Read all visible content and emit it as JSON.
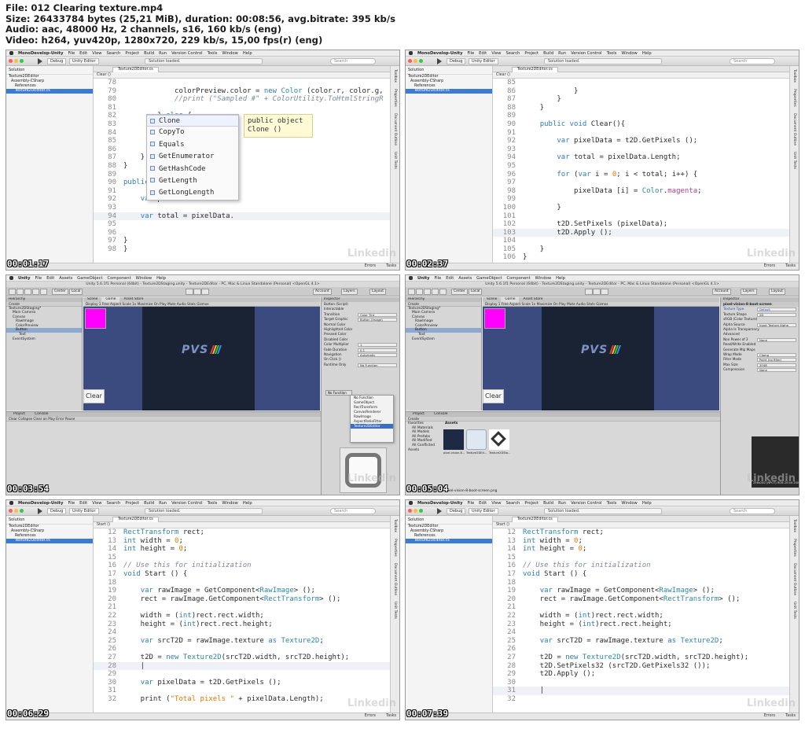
{
  "header": {
    "line1": "File: 012 Clearing texture.mp4",
    "line2": "Size: 26433784 bytes (25,21 MiB), duration: 00:08:56, avg.bitrate: 395 kb/s",
    "line3": "Audio: aac, 48000 Hz, 2 channels, s16, 160 kb/s (eng)",
    "line4": "Video: h264, yuv420p, 1280x720, 229 kb/s, 15,00 fps(r) (eng)"
  },
  "watermark": "Linkedin",
  "colors": {
    "accent_blue": "#3b7bd6",
    "keyword": "#2f7bbf",
    "number": "#e07800",
    "magenta": "#ff00ff",
    "game_bg": "#3b4b80"
  },
  "monodevelop": {
    "menu": [
      "MonoDevelop-Unity",
      "File",
      "Edit",
      "View",
      "Search",
      "Project",
      "Build",
      "Run",
      "Version Control",
      "Tools",
      "Window",
      "Help"
    ],
    "config": "Debug",
    "target": "Unity Editor",
    "status": "Solution loaded.",
    "search_placeholder": "Search",
    "sidebar_title": "Solution",
    "tree": [
      "Texture2DEditor",
      "Assembly-CSharp",
      "References",
      "Texture2DEditor.cs"
    ],
    "tab": "Texture2DEditor.cs",
    "right_pads": [
      "Toolbox",
      "Properties",
      "Document Outline",
      "Unit Tests"
    ],
    "status_right": [
      "Errors",
      "Tasks"
    ]
  },
  "unity": {
    "menu": [
      "Unity",
      "File",
      "Edit",
      "Assets",
      "GameObject",
      "Component",
      "Window",
      "Help"
    ],
    "title": "Unity 5.6.1f1 Personal (64bit) - Texture2DStaging.unity - Texture2DEditor - PC, Mac & Linux Standalone (Personal) <OpenGL 4.1>",
    "pivot": "Center",
    "space": "Local",
    "account": "Account",
    "layers": "Layers",
    "layout": "Layout",
    "hierarchy_tab": "Hierarchy",
    "hierarchy_create": "Create",
    "hierarchy_items": [
      "Texture2DStaging*",
      "Main Camera",
      "Canvas",
      "RawImage",
      "ColorPreview",
      "Button",
      "Text",
      "EventSystem"
    ],
    "scene_tabs": [
      "Scene",
      "Game",
      "Asset Store"
    ],
    "game_bar": "Display 1   Free Aspect   Scale   1x   Maximize On Play   Mute Audio   Stats   Gizmos",
    "clear_button": "Clear",
    "logo_text": "PVS",
    "project_tabs": [
      "Project",
      "Console"
    ],
    "console_bar": "Clear   Collapse   Clear on Play   Error Pause",
    "inspector_tab": "Inspector",
    "button_inspector": [
      {
        "label": "Button (Script)",
        "value": ""
      },
      {
        "label": "Interactable",
        "value": ""
      },
      {
        "label": "Transition",
        "value": "Color Tint"
      },
      {
        "label": "Target Graphic",
        "value": "Button (Image)"
      },
      {
        "label": "Normal Color",
        "value": ""
      },
      {
        "label": "Highlighted Color",
        "value": ""
      },
      {
        "label": "Pressed Color",
        "value": ""
      },
      {
        "label": "Disabled Color",
        "value": ""
      },
      {
        "label": "Color Multiplier",
        "value": "1"
      },
      {
        "label": "Fade Duration",
        "value": "0.1"
      },
      {
        "label": "Navigation",
        "value": "Automatic"
      },
      {
        "label": "On Click ()",
        "value": ""
      },
      {
        "label": "Runtime Only",
        "value": "No Function"
      }
    ],
    "context_menu_top": "No Function",
    "context_menu": [
      "No Function",
      "GameObject",
      "RectTransform",
      "CanvasRenderer",
      "RawImage",
      "AspectRatioFitter",
      "Texture2DEditor"
    ],
    "preview_label": "Button",
    "texture_inspector_name": "pixel-vision-8-boot-screen",
    "texture_inspector": [
      {
        "label": "Texture Type",
        "value": "Default"
      },
      {
        "label": "Texture Shape",
        "value": "2D"
      },
      {
        "label": "sRGB (Color Texture)",
        "value": ""
      },
      {
        "label": "Alpha Source",
        "value": "Input Texture Alpha"
      },
      {
        "label": "Alpha Is Transparency",
        "value": ""
      },
      {
        "label": "Advanced",
        "value": ""
      },
      {
        "label": "Non Power of 2",
        "value": "None"
      },
      {
        "label": "Read/Write Enabled",
        "value": ""
      },
      {
        "label": "Generate Mip Maps",
        "value": ""
      },
      {
        "label": "Wrap Mode",
        "value": "Clamp"
      },
      {
        "label": "Filter Mode",
        "value": "Point (no filter)"
      },
      {
        "label": "Max Size",
        "value": "2048"
      },
      {
        "label": "Compression",
        "value": "None"
      }
    ],
    "texture_info": "256x240 (NPOT)  RGB 24 bit   240.0 KB",
    "favorites": [
      "Favorites",
      "All Materials",
      "All Models",
      "All Prefabs",
      "All Modified",
      "All Conflicted",
      "Assets"
    ],
    "assets_header": "Assets",
    "assets": [
      "pixel-vision-8...",
      "Texture2DEd...",
      "Texture2DSta..."
    ],
    "asset_path": "pixel-vision-8-boot-screen.png"
  },
  "frames": [
    {
      "timestamp": "00:01:17",
      "breadcrumb": "Clear ()",
      "code": [
        {
          "n": "78",
          "t": ""
        },
        {
          "n": "79",
          "t": "            colorPreview.color = new Color (color.r, color.g,"
        },
        {
          "n": "80",
          "t": "            //print (\"Sampled #\" + ColorUtility.ToHtmlStringR"
        },
        {
          "n": "81",
          "t": ""
        },
        {
          "n": "82",
          "t": "        } else {"
        },
        {
          "n": "83",
          "t": ""
        },
        {
          "n": "84",
          "t": "            colorPreview"
        },
        {
          "n": "85",
          "t": ""
        },
        {
          "n": "86",
          "t": "        }"
        },
        {
          "n": "87",
          "t": "    }"
        },
        {
          "n": "88",
          "t": "}"
        },
        {
          "n": "89",
          "t": ""
        },
        {
          "n": "90",
          "t": "public void Clear(){"
        },
        {
          "n": "91",
          "t": ""
        },
        {
          "n": "92",
          "t": "    var pixelData = t2D."
        },
        {
          "n": "93",
          "t": ""
        },
        {
          "n": "94",
          "t": "    var total = pixelData."
        },
        {
          "n": "95",
          "t": ""
        },
        {
          "n": "96",
          "t": ""
        },
        {
          "n": "97",
          "t": "}"
        },
        {
          "n": "98",
          "t": "}"
        }
      ],
      "completion": [
        "Clone",
        "CopyTo",
        "Equals",
        "GetEnumerator",
        "GetHashCode",
        "GetLength",
        "GetLongLength"
      ],
      "tooltip": "public object\nClone ()"
    },
    {
      "timestamp": "00:02:37",
      "breadcrumb": "Clear ()",
      "code": [
        {
          "n": "85",
          "t": ""
        },
        {
          "n": "86",
          "t": "            }"
        },
        {
          "n": "87",
          "t": "        }"
        },
        {
          "n": "88",
          "t": "    }"
        },
        {
          "n": "89",
          "t": ""
        },
        {
          "n": "90",
          "t": "    public void Clear(){"
        },
        {
          "n": "91",
          "t": ""
        },
        {
          "n": "92",
          "t": "        var pixelData = t2D.GetPixels ();"
        },
        {
          "n": "93",
          "t": ""
        },
        {
          "n": "94",
          "t": "        var total = pixelData.Length;"
        },
        {
          "n": "95",
          "t": ""
        },
        {
          "n": "96",
          "t": "        for (var i = 0; i < total; i++) {"
        },
        {
          "n": "97",
          "t": ""
        },
        {
          "n": "98",
          "t": "            pixelData [i] = Color.magenta;"
        },
        {
          "n": "99",
          "t": ""
        },
        {
          "n": "100",
          "t": "        }"
        },
        {
          "n": "101",
          "t": ""
        },
        {
          "n": "102",
          "t": "        t2D.SetPixels (pixelData);"
        },
        {
          "n": "103",
          "t": "        t2D.Apply ();"
        },
        {
          "n": "104",
          "t": ""
        },
        {
          "n": "105",
          "t": "    }"
        },
        {
          "n": "106",
          "t": "}"
        }
      ]
    },
    {
      "timestamp": "00:03:54"
    },
    {
      "timestamp": "00:05:04"
    },
    {
      "timestamp": "00:06:29",
      "breadcrumb": "Start ()",
      "code": [
        {
          "n": "12",
          "t": "RectTransform rect;"
        },
        {
          "n": "13",
          "t": "int width = 0;"
        },
        {
          "n": "14",
          "t": "int height = 0;"
        },
        {
          "n": "15",
          "t": ""
        },
        {
          "n": "16",
          "t": "// Use this for initialization"
        },
        {
          "n": "17",
          "t": "void Start () {"
        },
        {
          "n": "18",
          "t": ""
        },
        {
          "n": "19",
          "t": "    var rawImage = GetComponent<RawImage> ();"
        },
        {
          "n": "20",
          "t": "    rect = rawImage.GetComponent<RectTransform> ();"
        },
        {
          "n": "21",
          "t": ""
        },
        {
          "n": "22",
          "t": "    width = (int)rect.rect.width;"
        },
        {
          "n": "23",
          "t": "    height = (int)rect.rect.height;"
        },
        {
          "n": "24",
          "t": ""
        },
        {
          "n": "25",
          "t": "    var srcT2D = rawImage.texture as Texture2D;"
        },
        {
          "n": "26",
          "t": ""
        },
        {
          "n": "27",
          "t": "    t2D = new Texture2D(srcT2D.width, srcT2D.height);"
        },
        {
          "n": "28",
          "t": "    |"
        },
        {
          "n": "29",
          "t": ""
        },
        {
          "n": "30",
          "t": "    var pixelData = t2D.GetPixels ();"
        },
        {
          "n": "31",
          "t": ""
        },
        {
          "n": "32",
          "t": "    print (\"Total pixels \" + pixelData.Length);"
        }
      ]
    },
    {
      "timestamp": "00:07:39",
      "breadcrumb": "Start ()",
      "code": [
        {
          "n": "12",
          "t": "RectTransform rect;"
        },
        {
          "n": "13",
          "t": "int width = 0;"
        },
        {
          "n": "14",
          "t": "int height = 0;"
        },
        {
          "n": "15",
          "t": ""
        },
        {
          "n": "16",
          "t": "// Use this for initialization"
        },
        {
          "n": "17",
          "t": "void Start () {"
        },
        {
          "n": "18",
          "t": ""
        },
        {
          "n": "19",
          "t": "    var rawImage = GetComponent<RawImage> ();"
        },
        {
          "n": "20",
          "t": "    rect = rawImage.GetComponent<RectTransform> ();"
        },
        {
          "n": "21",
          "t": ""
        },
        {
          "n": "22",
          "t": "    width = (int)rect.rect.width;"
        },
        {
          "n": "23",
          "t": "    height = (int)rect.rect.height;"
        },
        {
          "n": "24",
          "t": ""
        },
        {
          "n": "25",
          "t": "    var srcT2D = rawImage.texture as Texture2D;"
        },
        {
          "n": "26",
          "t": ""
        },
        {
          "n": "27",
          "t": "    t2D = new Texture2D(srcT2D.width, srcT2D.height);"
        },
        {
          "n": "28",
          "t": "    t2D.SetPixels32 (srcT2D.GetPixels32 ());"
        },
        {
          "n": "29",
          "t": "    t2D.Apply ();"
        },
        {
          "n": "30",
          "t": ""
        },
        {
          "n": "31",
          "t": "    |"
        },
        {
          "n": "32",
          "t": ""
        }
      ]
    }
  ]
}
